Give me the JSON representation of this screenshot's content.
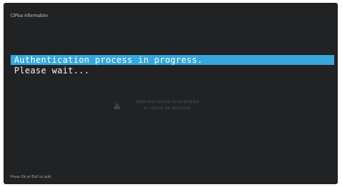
{
  "screen": {
    "title": "CIPlus information",
    "auth_message": "Authentication process in progress.",
    "wait_message": "Please wait...",
    "notice_line1": "Selected service is scrambled",
    "notice_line2": "or cannot be decoded.",
    "notice_icon": "warning-icon",
    "footer_hint": "Press Ok or Exit to quit"
  },
  "colors": {
    "background": "#212224",
    "highlight": "#36a8dc",
    "text": "#ffffff",
    "muted_notice": "#4e5054"
  }
}
